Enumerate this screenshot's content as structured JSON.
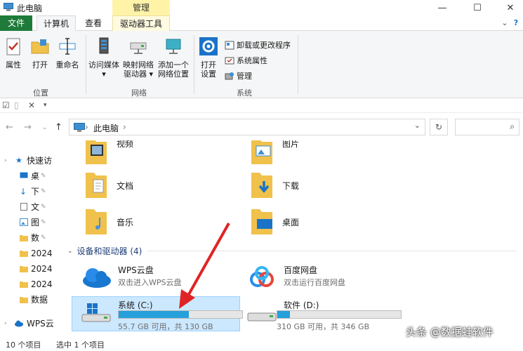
{
  "window": {
    "title": "此电脑",
    "context_tab": "管理",
    "min": "—",
    "max": "☐",
    "close": "✕"
  },
  "tabs": [
    {
      "label": "文件"
    },
    {
      "label": "计算机"
    },
    {
      "label": "查看"
    },
    {
      "label": "驱动器工具"
    }
  ],
  "ribbon": {
    "location_group": {
      "label": "位置",
      "buttons": [
        {
          "label": "属性",
          "icon": "checklist-icon"
        },
        {
          "label": "打开",
          "icon": "folder-open-icon"
        },
        {
          "label": "重命名",
          "icon": "rename-icon"
        }
      ]
    },
    "network_group": {
      "label": "网络",
      "buttons": [
        {
          "label": "访问媒体",
          "label2": "▾",
          "icon": "media-server-icon"
        },
        {
          "label": "映射网络",
          "label2": "驱动器 ▾",
          "icon": "network-drive-icon"
        },
        {
          "label": "添加一个",
          "label2": "网络位置",
          "icon": "network-location-icon"
        }
      ]
    },
    "system_group": {
      "label": "系统",
      "open_settings": {
        "label": "打开",
        "label2": "设置",
        "icon": "gear-icon"
      },
      "small": [
        {
          "label": "卸载或更改程序",
          "icon": "uninstall-icon"
        },
        {
          "label": "系统属性",
          "icon": "system-properties-icon"
        },
        {
          "label": "管理",
          "icon": "manage-icon"
        }
      ]
    }
  },
  "address": {
    "crumb": "此电脑",
    "sep": "›",
    "dropdown": "⌄",
    "refresh": "↻",
    "search_placeholder": "",
    "search_icon": "⌕"
  },
  "nav_pane": [
    {
      "label": "快速访",
      "icon": "star-icon",
      "type": "header"
    },
    {
      "label": "桌",
      "icon": "desktop-icon",
      "pinned": true
    },
    {
      "label": "下",
      "icon": "download-icon",
      "pinned": true
    },
    {
      "label": "文",
      "icon": "document-icon",
      "pinned": true
    },
    {
      "label": "图",
      "icon": "picture-icon",
      "pinned": true
    },
    {
      "label": "数",
      "icon": "folder-icon",
      "pinned": true
    },
    {
      "label": "2024",
      "icon": "folder-icon"
    },
    {
      "label": "2024",
      "icon": "folder-icon"
    },
    {
      "label": "2024",
      "icon": "folder-icon"
    },
    {
      "label": "数据",
      "icon": "folder-icon"
    },
    {
      "label": "WPS云",
      "icon": "cloud-icon",
      "type": "header"
    }
  ],
  "folders": [
    {
      "label": "视频",
      "icon": "video-folder-icon"
    },
    {
      "label": "图片",
      "icon": "pictures-folder-icon"
    },
    {
      "label": "文档",
      "icon": "documents-folder-icon"
    },
    {
      "label": "下载",
      "icon": "downloads-folder-icon"
    },
    {
      "label": "音乐",
      "icon": "music-folder-icon"
    },
    {
      "label": "桌面",
      "icon": "desktop-folder-icon"
    }
  ],
  "devices_section": {
    "title": "设备和驱动器 (4)",
    "chevron": "⌄"
  },
  "devices": [
    {
      "name": "WPS云盘",
      "sub": "双击进入WPS云盘",
      "icon": "wps-cloud-icon"
    },
    {
      "name": "百度网盘",
      "sub": "双击运行百度网盘",
      "icon": "baidu-netdisk-icon"
    },
    {
      "name": "系统 (C:)",
      "sub": "55.7 GB 可用，共 130 GB",
      "icon": "windows-drive-icon",
      "used_fraction": 0.57,
      "selected": true
    },
    {
      "name": "软件 (D:)",
      "sub": "310 GB 可用，共 346 GB",
      "icon": "drive-icon",
      "used_fraction": 0.104
    }
  ],
  "status": {
    "count": "10 个项目",
    "selected": "选中 1 个项目"
  },
  "watermark": "头条 @数据蛙软件",
  "colors": {
    "file_tab": "#1e7b3a",
    "manage_context": "#fff3a8",
    "drive_bar": "#26a0da",
    "selection": "#cce8ff",
    "arrow": "#e02424"
  }
}
